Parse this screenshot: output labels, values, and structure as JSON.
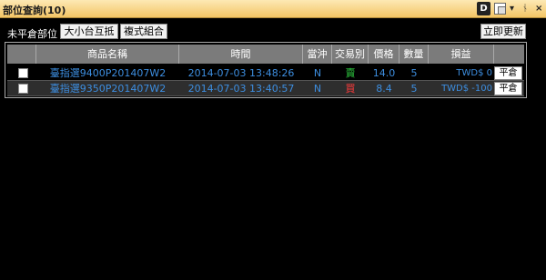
{
  "window": {
    "title": "部位查詢(10)",
    "controls": {
      "d_label": "D",
      "arrow": "▾",
      "pin": "ᚾ",
      "close": "×"
    }
  },
  "toolbar": {
    "label": "未平倉部位",
    "buttons": [
      "大小台互抵",
      "複式組合"
    ],
    "refresh": "立即更新"
  },
  "table": {
    "headers": [
      "商品名稱",
      "時間",
      "當沖",
      "交易別",
      "價格",
      "數量",
      "損益"
    ],
    "rows": [
      {
        "product": "臺指選9400P201407W2",
        "time": "2014-07-03 13:48:26",
        "daytrade": "N",
        "side": "賣",
        "price": "14.0",
        "qty": "5",
        "pnl": "TWD$ 0",
        "action": "平倉"
      },
      {
        "product": "臺指選9350P201407W2",
        "time": "2014-07-03 13:40:57",
        "daytrade": "N",
        "side": "買",
        "price": "8.4",
        "qty": "5",
        "pnl": "TWD$ -100",
        "action": "平倉"
      }
    ]
  },
  "colors": {
    "sell": "#2ecc40",
    "buy": "#ff3b3b",
    "value": "#3d8ee0",
    "title_bar": "#f3c566"
  }
}
